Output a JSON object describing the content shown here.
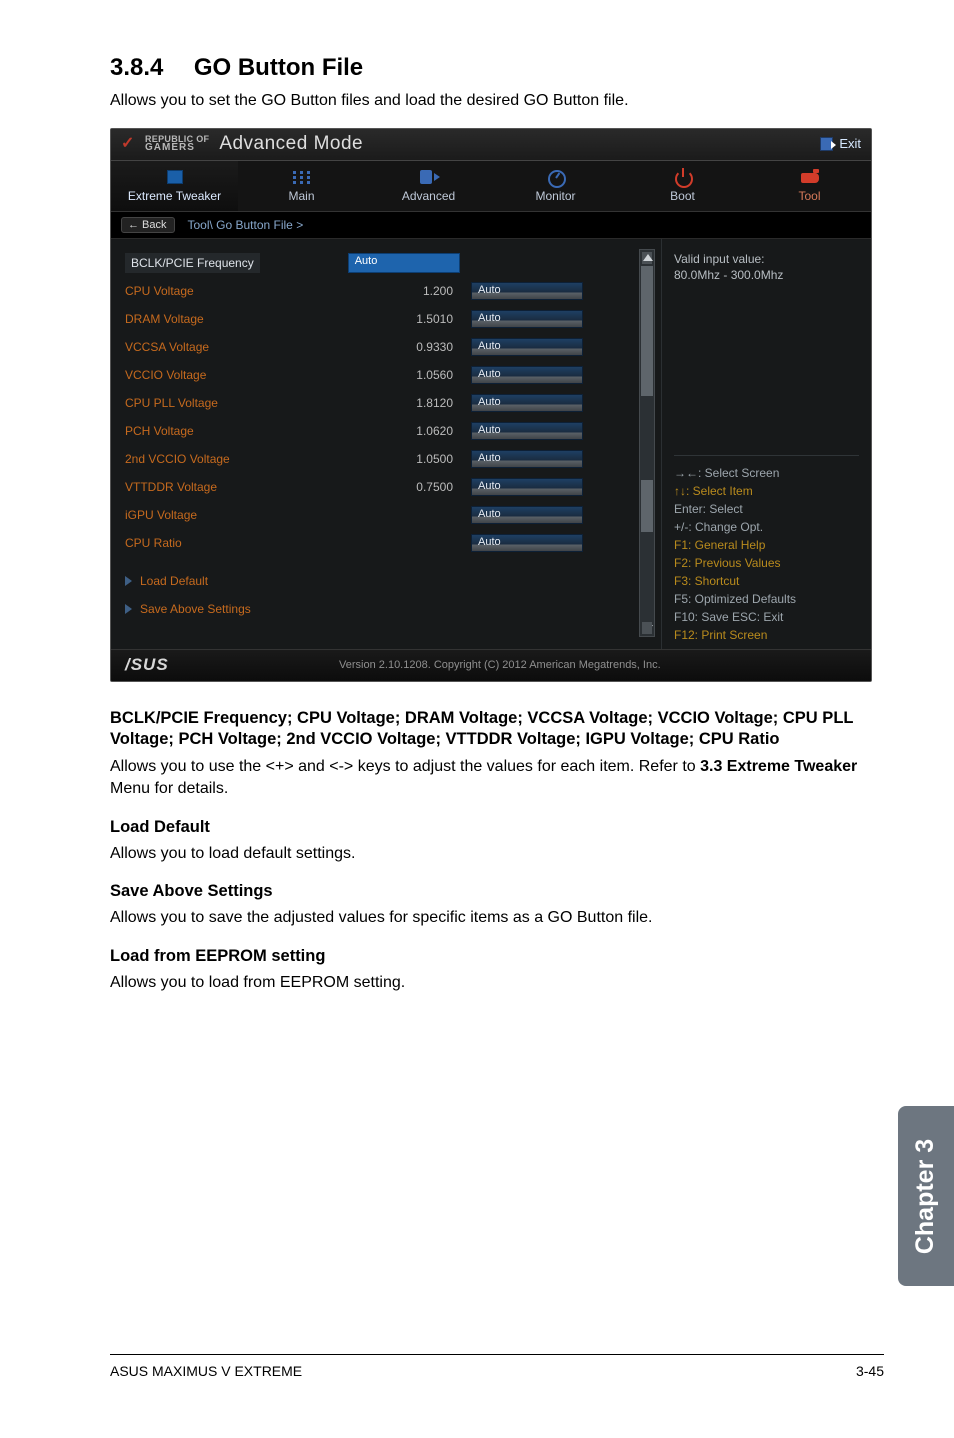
{
  "section": {
    "number": "3.8.4",
    "title": "GO Button File"
  },
  "lead": "Allows you to set the GO Button files and load the desired GO Button file.",
  "bios": {
    "logo_line1": "REPUBLIC OF",
    "logo_line2": "GAMERS",
    "mode": "Advanced Mode",
    "exit": "Exit",
    "tabs": {
      "extreme_tweaker": "Extreme Tweaker",
      "main": "Main",
      "advanced": "Advanced",
      "monitor": "Monitor",
      "boot": "Boot",
      "tool": "Tool"
    },
    "back": "Back",
    "breadcrumb": "Tool\\ Go Button File >",
    "header_row": {
      "label": "BCLK/PCIE Frequency",
      "auto": "Auto"
    },
    "rows": [
      {
        "label": "CPU Voltage",
        "value": "1.200",
        "auto": "Auto"
      },
      {
        "label": "DRAM Voltage",
        "value": "1.5010",
        "auto": "Auto"
      },
      {
        "label": "VCCSA Voltage",
        "value": "0.9330",
        "auto": "Auto"
      },
      {
        "label": "VCCIO Voltage",
        "value": "1.0560",
        "auto": "Auto"
      },
      {
        "label": "CPU PLL Voltage",
        "value": "1.8120",
        "auto": "Auto"
      },
      {
        "label": "PCH Voltage",
        "value": "1.0620",
        "auto": "Auto"
      },
      {
        "label": "2nd VCCIO Voltage",
        "value": "1.0500",
        "auto": "Auto"
      },
      {
        "label": "VTTDDR Voltage",
        "value": "0.7500",
        "auto": "Auto"
      },
      {
        "label": "iGPU Voltage",
        "value": "",
        "auto": "Auto"
      },
      {
        "label": "CPU Ratio",
        "value": "",
        "auto": "Auto"
      }
    ],
    "actions": {
      "load_default": "Load Default",
      "save_above": "Save Above Settings"
    },
    "side": {
      "valid_label": "Valid input value:",
      "valid_range": "80.0Mhz - 300.0Mhz",
      "hints": {
        "arrows": "→←: Select Screen",
        "updown": "↑↓: Select Item",
        "enter": "Enter: Select",
        "plusminus": "+/-: Change Opt.",
        "f1": "F1: General Help",
        "f2": "F2: Previous Values",
        "f3": "F3: Shortcut",
        "f5": "F5: Optimized Defaults",
        "f10": "F10: Save  ESC: Exit",
        "f12": "F12: Print Screen"
      }
    },
    "footer": {
      "asus": "/SUS",
      "copyright": "Version 2.10.1208. Copyright (C) 2012 American Megatrends, Inc."
    }
  },
  "desc1_h": "BCLK/PCIE Frequency; CPU Voltage; DRAM Voltage; VCCSA Voltage; VCCIO Voltage; CPU PLL Voltage; PCH Voltage; 2nd VCCIO Voltage; VTTDDR Voltage; IGPU Voltage; CPU Ratio",
  "desc1_p1": "Allows you to use the <+> and <-> keys to adjust the values for each item. Refer to ",
  "desc1_p1b": "3.3 Extreme Tweaker",
  "desc1_p1c": " Menu for details.",
  "load_default_h": "Load Default",
  "load_default_p": "Allows you to load default settings.",
  "save_above_h": "Save Above Settings",
  "save_above_p": "Allows you to save the adjusted values for specific items as a GO Button file.",
  "load_eeprom_h": "Load from EEPROM setting",
  "load_eeprom_p": "Allows you to load from EEPROM setting.",
  "chapter_tab": "Chapter 3",
  "footer_left": "ASUS MAXIMUS V EXTREME",
  "footer_right": "3-45"
}
